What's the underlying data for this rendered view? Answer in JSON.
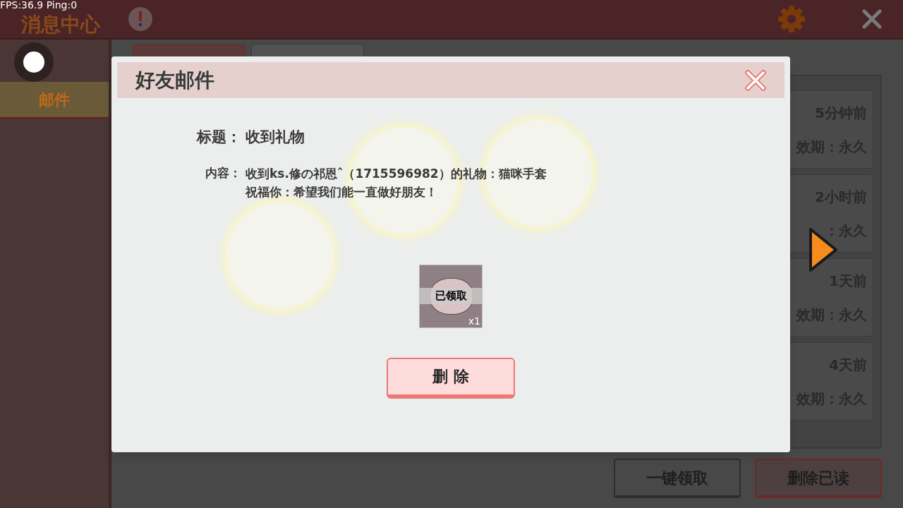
{
  "debug_overlay": "FPS:36.9  Ping:0",
  "header": {
    "title": "消息中心"
  },
  "sidebar": {
    "items": [
      {
        "label": "邮件",
        "selected": true
      }
    ]
  },
  "mail_list": [
    {
      "time": "5分钟前",
      "expiry": "效期：永久"
    },
    {
      "time": "2小时前",
      "expiry": "：永久"
    },
    {
      "time": "1天前",
      "expiry": "效期：永久"
    },
    {
      "time": "4天前",
      "expiry": "效期：永久"
    }
  ],
  "footer_buttons": [
    {
      "label": "一键领取",
      "kind": "plain"
    },
    {
      "label": "删除已读",
      "kind": "danger"
    }
  ],
  "dialog": {
    "title": "好友邮件",
    "subject_label": "标题：",
    "subject": "收到礼物",
    "content_label": "内容：",
    "content_lines": [
      "收到ks.修の祁恩ˆ（1715596982）的礼物：猫咪手套",
      "祝福你：希望我们能一直做好朋友！"
    ],
    "attachment": {
      "status": "已领取",
      "count": "x1",
      "claimed": true
    },
    "button": "删 除"
  }
}
